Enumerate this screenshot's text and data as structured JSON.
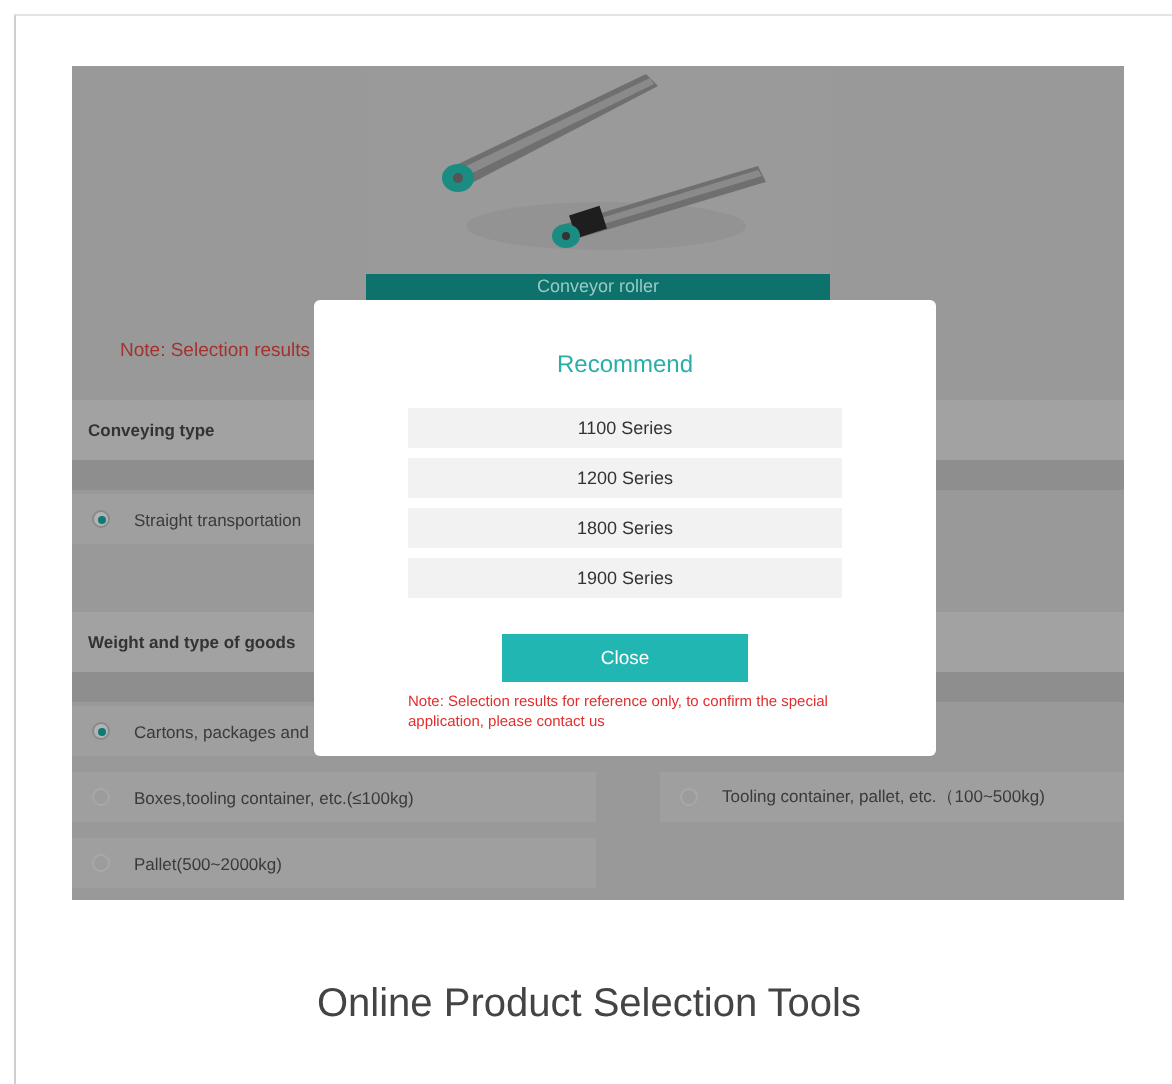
{
  "product": {
    "label": "Conveyor roller"
  },
  "note": "Note: Selection results",
  "sections": [
    {
      "title": "Conveying type",
      "rows": [
        [
          {
            "label": "Straight transportation",
            "selected": true
          }
        ]
      ]
    },
    {
      "title": "Weight and type of goods",
      "rows": [
        [
          {
            "label": "Cartons, packages and",
            "selected": true
          }
        ],
        [
          {
            "label": "Boxes,tooling container, etc.(≤100kg)",
            "selected": false
          },
          {
            "label": "Tooling container, pallet, etc.（100~500kg)",
            "selected": false
          }
        ],
        [
          {
            "label": "Pallet(500~2000kg)",
            "selected": false
          }
        ]
      ]
    }
  ],
  "modal": {
    "title": "Recommend",
    "items": [
      "1100 Series",
      "1200 Series",
      "1800 Series",
      "1900 Series"
    ],
    "button": "Close",
    "note": "Note: Selection results for reference only, to confirm the special application, please contact us"
  },
  "footer": {
    "title": "Online Product Selection Tools"
  }
}
